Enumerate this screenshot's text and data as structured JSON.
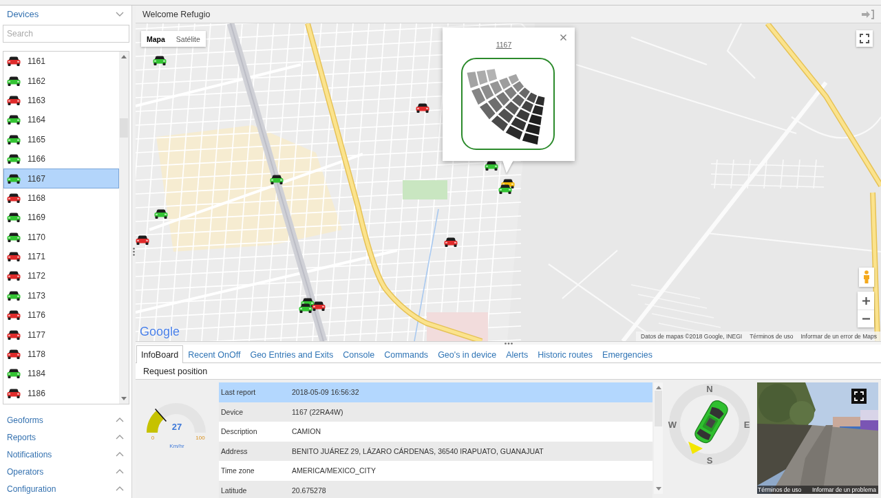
{
  "header": {
    "title": "Welcome Refugio"
  },
  "sidebar": {
    "devices": {
      "title": "Devices",
      "expanded": true,
      "search": {
        "placeholder": "Search"
      },
      "items": [
        {
          "label": "1161",
          "color": "#e02b2b",
          "selected": false
        },
        {
          "label": "1162",
          "color": "#33c433",
          "selected": false
        },
        {
          "label": "1163",
          "color": "#e02b2b",
          "selected": false
        },
        {
          "label": "1164",
          "color": "#33c433",
          "selected": false
        },
        {
          "label": "1165",
          "color": "#33c433",
          "selected": false
        },
        {
          "label": "1166",
          "color": "#33c433",
          "selected": false
        },
        {
          "label": "1167",
          "color": "#33c433",
          "selected": true
        },
        {
          "label": "1168",
          "color": "#e02b2b",
          "selected": false
        },
        {
          "label": "1169",
          "color": "#33c433",
          "selected": false
        },
        {
          "label": "1170",
          "color": "#33c433",
          "selected": false
        },
        {
          "label": "1171",
          "color": "#e02b2b",
          "selected": false
        },
        {
          "label": "1172",
          "color": "#e02b2b",
          "selected": false
        },
        {
          "label": "1173",
          "color": "#33c433",
          "selected": false
        },
        {
          "label": "1176",
          "color": "#e02b2b",
          "selected": false
        },
        {
          "label": "1177",
          "color": "#e02b2b",
          "selected": false
        },
        {
          "label": "1178",
          "color": "#e02b2b",
          "selected": false
        },
        {
          "label": "1184",
          "color": "#33c433",
          "selected": false
        },
        {
          "label": "1186",
          "color": "#e02b2b",
          "selected": false
        }
      ]
    },
    "sections": [
      {
        "title": "Geoforms",
        "expanded": false
      },
      {
        "title": "Reports",
        "expanded": false
      },
      {
        "title": "Notifications",
        "expanded": false
      },
      {
        "title": "Operators",
        "expanded": false
      },
      {
        "title": "Configuration",
        "expanded": false
      }
    ]
  },
  "map": {
    "map_types": [
      {
        "label": "Mapa",
        "selected": true
      },
      {
        "label": "Satélite",
        "selected": false
      }
    ],
    "markers": [
      {
        "color": "#33c433"
      },
      {
        "color": "#e02b2b"
      },
      {
        "color": "#33c433"
      },
      {
        "color": "#33c433"
      },
      {
        "color": "#f2b705"
      },
      {
        "color": "#33c433"
      },
      {
        "color": "#33c433"
      },
      {
        "color": "#e02b2b"
      },
      {
        "color": "#e02b2b"
      },
      {
        "color": "#33c433"
      },
      {
        "color": "#e02b2b"
      },
      {
        "color": "#33c433"
      }
    ],
    "popup": {
      "title": "1167"
    },
    "logo": "Google",
    "attribution": [
      "Datos de mapas ©2018 Google, INEGI",
      "Términos de uso",
      "Informar de un error de Maps"
    ]
  },
  "tabs": [
    {
      "label": "InfoBoard",
      "selected": true
    },
    {
      "label": "Recent OnOff",
      "selected": false
    },
    {
      "label": "Geo Entries and Exits",
      "selected": false
    },
    {
      "label": "Console",
      "selected": false
    },
    {
      "label": "Commands",
      "selected": false
    },
    {
      "label": "Geo's in device",
      "selected": false
    },
    {
      "label": "Alerts",
      "selected": false
    },
    {
      "label": "Historic routes",
      "selected": false
    },
    {
      "label": "Emergencies",
      "selected": false
    }
  ],
  "toolbar": {
    "button": "Request position"
  },
  "speed_gauge": {
    "level": 0.27,
    "reading": "27",
    "scale_min": "0",
    "scale_max": "100",
    "unit": "Km/hr"
  },
  "info_table": {
    "rows": [
      {
        "label": "Last report",
        "value": "2018-05-09 16:56:32",
        "selected": true
      },
      {
        "label": "Device",
        "value": "1167 (22RA4W)",
        "selected": false
      },
      {
        "label": "Description",
        "value": "CAMION",
        "selected": false
      },
      {
        "label": "Address",
        "value": "BENITO JUÁREZ 29, LÁZARO CÁRDENAS, 36540 IRAPUATO, GUANAJUAT",
        "selected": false
      },
      {
        "label": "Time zone",
        "value": "AMERICA/MEXICO_CITY",
        "selected": false
      },
      {
        "label": "Latitude",
        "value": "20.675278",
        "selected": false
      }
    ]
  },
  "compass": {
    "north": "N",
    "east": "E",
    "south": "S",
    "west": "W"
  },
  "street_view": {
    "links": [
      "Términos de uso",
      "Informar de un problema"
    ]
  }
}
